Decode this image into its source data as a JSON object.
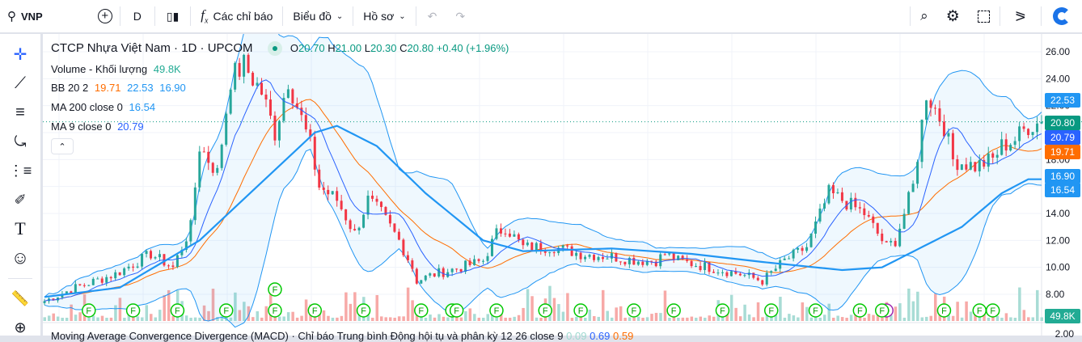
{
  "toolbar": {
    "symbol": "VNP",
    "interval": "D",
    "indicators": "Các chỉ báo",
    "chart": "Biểu đồ",
    "profile": "Hồ sơ"
  },
  "legend": {
    "title": "CTCP Nhựa Việt Nam · 1D · UPCOM",
    "o_label": "O",
    "o": "20.70",
    "h_label": "H",
    "h": "21.00",
    "l_label": "L",
    "l": "20.30",
    "c_label": "C",
    "c": "20.80",
    "change": "+0.40 (+1.96%)",
    "volume_label": "Volume - Khối lượng",
    "volume": "49.8K",
    "bb_label": "BB 20 2",
    "bb_mid": "19.71",
    "bb_up": "22.53",
    "bb_low": "16.90",
    "ma200_label": "MA 200 close 0",
    "ma200": "16.54",
    "ma9_label": "MA 9 close 0",
    "ma9": "20.79",
    "macd_label": "Moving Average Convergence Divergence (MACD) · Chỉ báo Trung bình Động hội tụ và phân kỳ 12 26 close 9",
    "macd_hist": "0.09",
    "macd": "0.69",
    "macd_signal": "0.59"
  },
  "price_labels": {
    "bb_up": "22.53",
    "close": "20.80",
    "ma9": "20.79",
    "bb_mid": "19.71",
    "bb_low": "16.90",
    "ma200": "16.54",
    "volume": "49.8K",
    "macd_axis": "2.00"
  },
  "colors": {
    "up": "#26a69a",
    "down": "#f23645",
    "ma200": "#2196f3",
    "bb": "#2196f3",
    "bbmid": "#ff6d00",
    "ma9": "#2962ff",
    "close": "#089981"
  },
  "chart_data": {
    "type": "candlestick",
    "title": "CTCP Nhựa Việt Nam · 1D · UPCOM",
    "yticks": [
      "26.00",
      "24.00",
      "22.00",
      "20.00",
      "18.00",
      "16.00",
      "14.00",
      "12.00",
      "10.00",
      "8.00"
    ],
    "ylim": [
      8,
      26
    ],
    "close_path_index": [
      0,
      7,
      16,
      24,
      29,
      33,
      35,
      39,
      42,
      45,
      49,
      52,
      55,
      57,
      60,
      62,
      66,
      70,
      73,
      76,
      80,
      83,
      84,
      88,
      94,
      99,
      102,
      104,
      108,
      115,
      121,
      128,
      134,
      138,
      140,
      143,
      150,
      157,
      162,
      167,
      172,
      177,
      180,
      185,
      190,
      192,
      196,
      199,
      203,
      205,
      210,
      214,
      216,
      219,
      222,
      225
    ],
    "close_path": [
      7.5,
      8.5,
      9.5,
      11,
      10,
      13,
      19,
      17,
      24,
      25,
      23,
      20,
      24,
      22,
      19,
      16,
      15,
      12.5,
      15,
      14,
      12,
      10,
      9,
      9.5,
      10,
      10.5,
      12.5,
      13,
      11.5,
      11.5,
      11,
      10.8,
      10.5,
      10.5,
      11,
      10.5,
      10,
      9.5,
      9,
      10.5,
      11.5,
      15.5,
      15,
      14,
      11.5,
      12,
      16,
      23,
      20.5,
      18,
      17.5,
      18,
      19,
      19.5,
      20.5,
      20.8
    ],
    "ma200": [
      7.8,
      8.5,
      12,
      16,
      20,
      20.5,
      19,
      15.5,
      12,
      11.2,
      11.4,
      11,
      10.4,
      9.8,
      10,
      11.5,
      13,
      15.5,
      16.54
    ],
    "ma200_index": [
      0,
      17,
      35,
      48,
      61,
      66,
      75,
      86,
      99,
      108,
      128,
      146,
      162,
      180,
      189,
      198,
      207,
      216,
      222
    ],
    "event_markers": [
      "F",
      "F",
      "F",
      "F",
      "F",
      "F",
      "F",
      "F",
      "F",
      "F",
      "F",
      "F",
      "F",
      "F",
      "F",
      "F",
      "F",
      "F",
      "F",
      "F",
      "D",
      "F",
      "F",
      "F",
      "F"
    ],
    "event_index": [
      10,
      20,
      30,
      41,
      52,
      52,
      61,
      72,
      85,
      92,
      93,
      102,
      113,
      121,
      133,
      142,
      153,
      164,
      174,
      184,
      190,
      189,
      203,
      211,
      214
    ]
  }
}
